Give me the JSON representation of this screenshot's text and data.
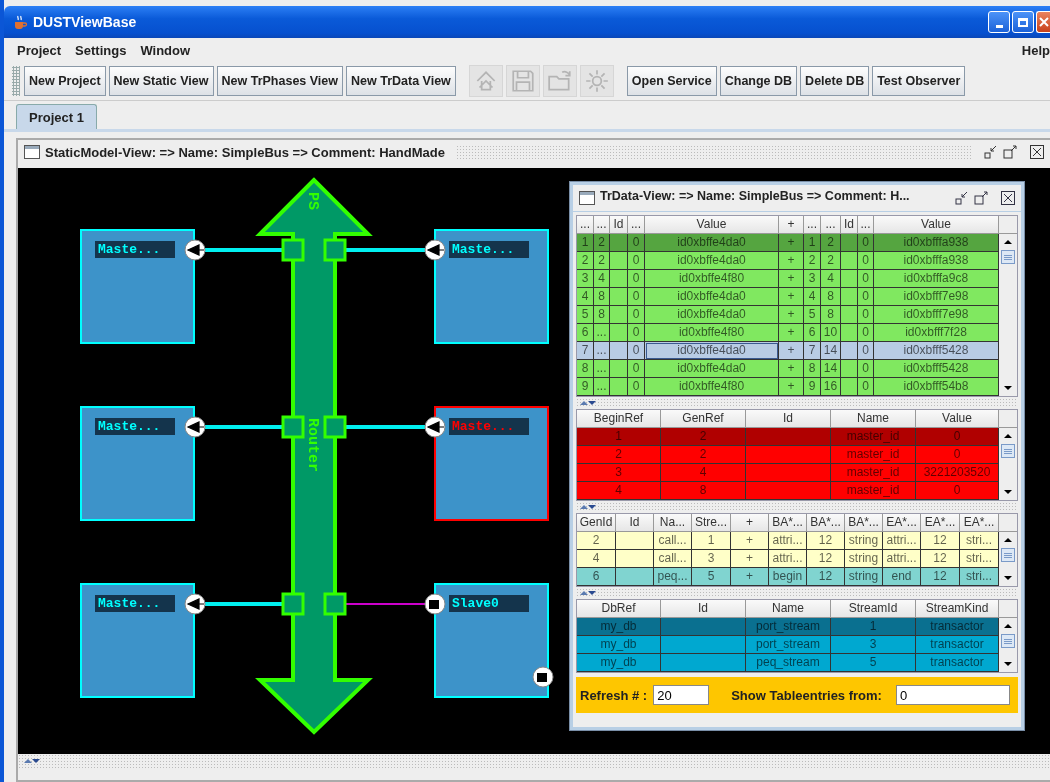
{
  "window": {
    "title": "DUSTViewBase"
  },
  "menu": {
    "items": [
      "Project",
      "Settings",
      "Window"
    ],
    "help": "Help"
  },
  "toolbar": {
    "groups": [
      [
        {
          "kind": "text",
          "label": "New Project",
          "disabled": false
        },
        {
          "kind": "text",
          "label": "New Static View",
          "disabled": false
        },
        {
          "kind": "text",
          "label": "New TrPhases View",
          "disabled": false
        },
        {
          "kind": "text",
          "label": "New TrData View",
          "disabled": false
        }
      ],
      [
        {
          "kind": "icon",
          "disabled": true
        },
        {
          "kind": "icon",
          "disabled": true
        },
        {
          "kind": "icon",
          "disabled": true
        },
        {
          "kind": "icon",
          "disabled": true
        }
      ],
      [
        {
          "kind": "text",
          "label": "Open Service",
          "disabled": false
        },
        {
          "kind": "text",
          "label": "Change DB",
          "disabled": false
        },
        {
          "kind": "text",
          "label": "Delete DB",
          "disabled": false
        },
        {
          "kind": "text",
          "label": "Test Observer",
          "disabled": false
        }
      ]
    ]
  },
  "tabs": [
    {
      "label": "Project 1",
      "selected": true
    }
  ],
  "static_view": {
    "title": "StaticModel-View:  => Name: SimpleBus => Comment: HandMade",
    "diagram": {
      "bus": {
        "labels": [
          "PS",
          "Router"
        ]
      },
      "blocks": [
        {
          "label": "Maste...",
          "kind": "master",
          "color": "#00ffff"
        },
        {
          "label": "Maste...",
          "kind": "master",
          "color": "#00ffff"
        },
        {
          "label": "Maste...",
          "kind": "master",
          "color": "#00ffff"
        },
        {
          "label": "Maste...",
          "kind": "master",
          "color": "#ff0000"
        },
        {
          "label": "Maste...",
          "kind": "master",
          "color": "#00ffff"
        },
        {
          "label": "Slave0",
          "kind": "slave",
          "color": "#00ffff"
        }
      ]
    }
  },
  "trdata_view": {
    "title": "TrData-View:  => Name: SimpleBus => Comment: H...",
    "tables": [
      {
        "columns": [
          "...",
          "...",
          "Id",
          "...",
          "Value",
          "+",
          "...",
          "...",
          "Id",
          "...",
          "Value"
        ],
        "rows": [
          {
            "color": "#55a540",
            "focused": false,
            "cells": [
              "1",
              "2",
              null,
              "0",
              "id0xbffe4da0",
              "+",
              "1",
              "2",
              null,
              "0",
              "id0xbfffa938"
            ]
          },
          {
            "color": "#80e860",
            "focused": false,
            "cells": [
              "2",
              "2",
              null,
              "0",
              "id0xbffe4da0",
              "+",
              "2",
              "2",
              null,
              "0",
              "id0xbfffa938"
            ]
          },
          {
            "color": "#80e860",
            "focused": false,
            "cells": [
              "3",
              "4",
              null,
              "0",
              "id0xbffe4f80",
              "+",
              "3",
              "4",
              null,
              "0",
              "id0xbfffa9c8"
            ]
          },
          {
            "color": "#80e860",
            "focused": false,
            "cells": [
              "4",
              "8",
              null,
              "0",
              "id0xbffe4da0",
              "+",
              "4",
              "8",
              null,
              "0",
              "id0xbfff7e98"
            ]
          },
          {
            "color": "#80e860",
            "focused": false,
            "cells": [
              "5",
              "8",
              null,
              "0",
              "id0xbffe4da0",
              "+",
              "5",
              "8",
              null,
              "0",
              "id0xbfff7e98"
            ]
          },
          {
            "color": "#80e860",
            "focused": false,
            "cells": [
              "6",
              "...",
              null,
              "0",
              "id0xbffe4f80",
              "+",
              "6",
              "10",
              null,
              "0",
              "id0xbfff7f28"
            ]
          },
          {
            "color": "#b8cce4",
            "focused": true,
            "cells": [
              "7",
              "...",
              null,
              "0",
              "id0xbffe4da0",
              "+",
              "7",
              "14",
              null,
              "0",
              "id0xbfff5428"
            ]
          },
          {
            "color": "#80e860",
            "focused": false,
            "cells": [
              "8",
              "...",
              null,
              "0",
              "id0xbffe4da0",
              "+",
              "8",
              "14",
              null,
              "0",
              "id0xbfff5428"
            ]
          },
          {
            "color": "#80e860",
            "focused": false,
            "cells": [
              "9",
              "...",
              null,
              "0",
              "id0xbffe4f80",
              "+",
              "9",
              "16",
              null,
              "0",
              "id0xbfff54b8"
            ]
          }
        ]
      },
      {
        "columns": [
          "BeginRef",
          "GenRef",
          "Id",
          "Name",
          "Value"
        ],
        "rows": [
          {
            "color": "#b00000",
            "cells": [
              "1",
              "2",
              null,
              "master_id",
              "0"
            ]
          },
          {
            "color": "#ff0000",
            "cells": [
              "2",
              "2",
              null,
              "master_id",
              "0"
            ]
          },
          {
            "color": "#ff0000",
            "cells": [
              "3",
              "4",
              null,
              "master_id",
              "3221203520"
            ]
          },
          {
            "color": "#ff0000",
            "cells": [
              "4",
              "8",
              null,
              "master_id",
              "0"
            ]
          }
        ]
      },
      {
        "columns": [
          "GenId",
          "Id",
          "Na...",
          "Stre...",
          "+",
          "BA*...",
          "BA*...",
          "BA*...",
          "EA*...",
          "EA*...",
          "EA*..."
        ],
        "rows": [
          {
            "color": "#ffffc8",
            "cells": [
              "2",
              null,
              "call...",
              "1",
              "+",
              "attri...",
              "12",
              "string",
              "attri...",
              "12",
              "stri..."
            ]
          },
          {
            "color": "#ffffc8",
            "cells": [
              "4",
              null,
              "call...",
              "3",
              "+",
              "attri...",
              "12",
              "string",
              "attri...",
              "12",
              "stri..."
            ]
          },
          {
            "color": "#80d4d0",
            "cells": [
              "6",
              null,
              "peq...",
              "5",
              "+",
              "begin",
              "12",
              "string",
              "end",
              "12",
              "stri..."
            ]
          }
        ]
      },
      {
        "columns": [
          "DbRef",
          "Id",
          "Name",
          "StreamId",
          "StreamKind"
        ],
        "rows": [
          {
            "color": "#0a7090",
            "cells": [
              "my_db",
              null,
              "port_stream",
              "1",
              "transactor"
            ]
          },
          {
            "color": "#00a8d0",
            "cells": [
              "my_db",
              null,
              "port_stream",
              "3",
              "transactor"
            ]
          },
          {
            "color": "#00a8d0",
            "cells": [
              "my_db",
              null,
              "peq_stream",
              "5",
              "transactor"
            ]
          }
        ]
      }
    ],
    "refresh": {
      "label": "Refresh # :",
      "value": "20"
    },
    "show_from": {
      "label": "Show Tableentries from:",
      "value": "0"
    }
  }
}
